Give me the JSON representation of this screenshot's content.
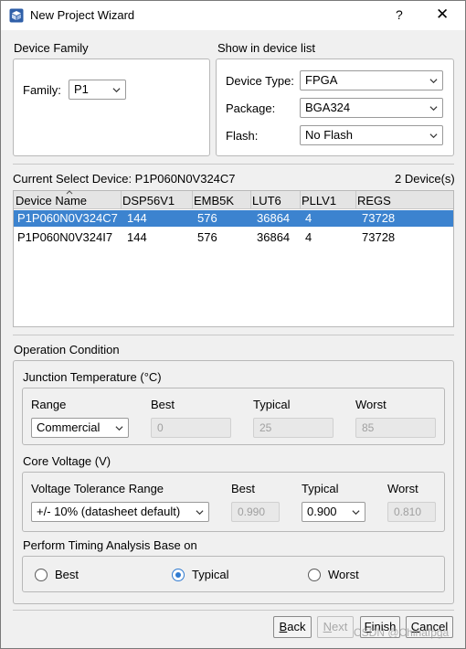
{
  "window": {
    "title": "New Project Wizard",
    "help_glyph": "?",
    "close_glyph": "✕",
    "accent": "#3c83cf"
  },
  "device_family": {
    "group_label": "Device Family",
    "family_label": "Family:",
    "family_value": "P1"
  },
  "device_list": {
    "group_label": "Show in device list",
    "type_label": "Device Type:",
    "type_value": "FPGA",
    "package_label": "Package:",
    "package_value": "BGA324",
    "flash_label": "Flash:",
    "flash_value": "No Flash"
  },
  "current": {
    "label": "Current Select Device: P1P060N0V324C7",
    "count": "2 Device(s)"
  },
  "table": {
    "columns": [
      "Device Name",
      "DSP56V1",
      "EMB5K",
      "LUT6",
      "PLLV1",
      "REGS"
    ],
    "rows": [
      {
        "name": "P1P060N0V324C7",
        "dsp": "144",
        "emb": "576",
        "lut": "36864",
        "pll": "4",
        "regs": "73728",
        "selected": true
      },
      {
        "name": "P1P060N0V324I7",
        "dsp": "144",
        "emb": "576",
        "lut": "36864",
        "pll": "4",
        "regs": "73728",
        "selected": false
      }
    ]
  },
  "operation": {
    "section_label": "Operation Condition",
    "junction": {
      "label": "Junction Temperature (°C)",
      "range_label": "Range",
      "range_value": "Commercial",
      "best_label": "Best",
      "best_value": "0",
      "typical_label": "Typical",
      "typical_value": "25",
      "worst_label": "Worst",
      "worst_value": "85"
    },
    "voltage": {
      "label": "Core Voltage (V)",
      "tolerance_label": "Voltage Tolerance Range",
      "tolerance_value": "+/- 10% (datasheet default)",
      "best_label": "Best",
      "best_value": "0.990",
      "typical_label": "Typical",
      "typical_value": "0.900",
      "worst_label": "Worst",
      "worst_value": "0.810"
    },
    "timing": {
      "label": "Perform Timing Analysis Base on",
      "options": [
        "Best",
        "Typical",
        "Worst"
      ],
      "selected": "Typical"
    }
  },
  "buttons": {
    "back_mnemonic": "B",
    "back_rest": "ack",
    "next_mnemonic": "N",
    "next_rest": "ext",
    "finish_mnemonic": "F",
    "finish_rest": "inish",
    "cancel_mnemonic": "C",
    "cancel_rest": "ancel"
  },
  "watermark": "CSDN @Chinafpga"
}
